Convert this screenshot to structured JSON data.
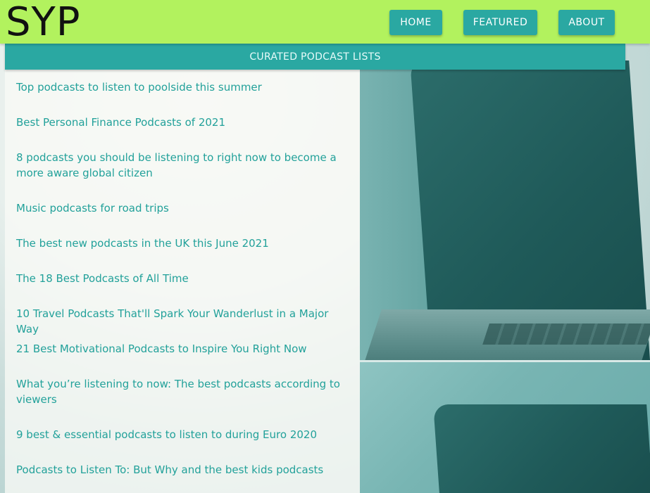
{
  "header": {
    "logo": "SYP",
    "nav": {
      "home": "HOME",
      "featured": "FEATURED",
      "about": "ABOUT"
    }
  },
  "section_title": "CURATED PODCAST LISTS",
  "lists": [
    "Top podcasts to listen to poolside this summer",
    "Best Personal Finance Podcasts of 2021",
    "8 podcasts you should be listening to right now to become a more aware global citizen",
    "Music podcasts for road trips",
    "The best new podcasts in the UK this June 2021",
    "The 18 Best Podcasts of All Time",
    "10 Travel Podcasts That'll Spark Your Wanderlust in a Major Way",
    "21 Best Motivational Podcasts to Inspire You Right Now",
    "What you’re listening to now: The best podcasts according to viewers",
    "9 best & essential podcasts to listen to during Euro 2020",
    "Podcasts to Listen To: But Why and the best kids podcasts"
  ],
  "colors": {
    "header_bg": "#b2f25e",
    "accent": "#2aa8a2",
    "link": "#22a19a"
  }
}
